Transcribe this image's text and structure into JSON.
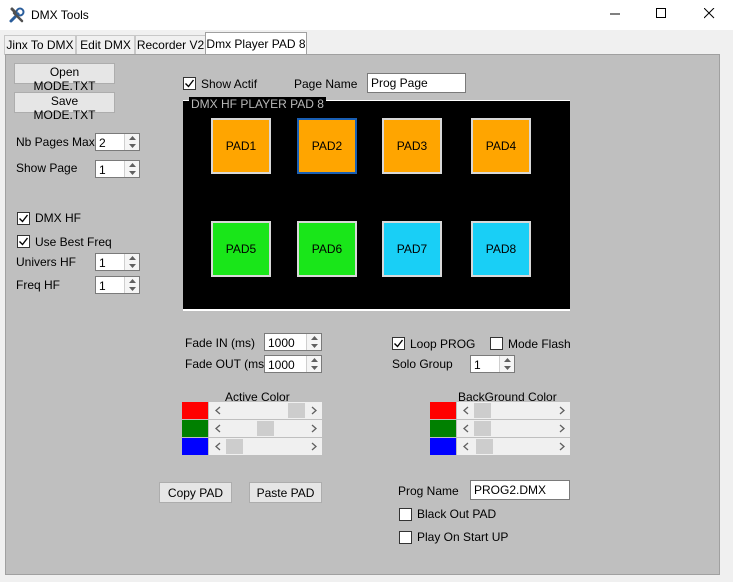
{
  "window": {
    "title": "DMX Tools"
  },
  "tabs": [
    "Jinx To DMX",
    "Edit DMX",
    "Recorder V2",
    "Dmx Player PAD 8"
  ],
  "left": {
    "open_label": "Open MODE.TXT",
    "save_label": "Save MODE.TXT",
    "nb_pages_label": "Nb Pages Max",
    "nb_pages_value": "2",
    "show_page_label": "Show Page",
    "show_page_value": "1",
    "dmx_hf_label": "DMX HF",
    "dmx_hf_checked": true,
    "best_freq_label": "Use Best Freq",
    "best_freq_checked": true,
    "univers_label": "Univers HF",
    "univers_value": "1",
    "freq_label": "Freq HF",
    "freq_value": "1"
  },
  "top": {
    "show_actif_label": "Show Actif",
    "show_actif_checked": true,
    "page_name_label": "Page Name",
    "page_name_value": "Prog Page"
  },
  "player": {
    "group_title": "DMX HF PLAYER PAD 8",
    "pads": [
      {
        "label": "PAD1",
        "color": "#ffa500"
      },
      {
        "label": "PAD2",
        "color": "#ffa500"
      },
      {
        "label": "PAD3",
        "color": "#ffa500"
      },
      {
        "label": "PAD4",
        "color": "#ffa500"
      },
      {
        "label": "PAD5",
        "color": "#19e619"
      },
      {
        "label": "PAD6",
        "color": "#19e619"
      },
      {
        "label": "PAD7",
        "color": "#19cff6"
      },
      {
        "label": "PAD8",
        "color": "#19cff6"
      }
    ]
  },
  "fade": {
    "in_label": "Fade IN (ms)",
    "in_value": "1000",
    "out_label": "Fade OUT (ms)",
    "out_value": "1000"
  },
  "options": {
    "loop_label": "Loop PROG",
    "loop_checked": true,
    "flash_label": "Mode Flash",
    "flash_checked": false,
    "solo_label": "Solo Group",
    "solo_value": "1"
  },
  "active_color": {
    "label": "Active Color",
    "levels": {
      "red": 1.0,
      "green": 0.5,
      "blue": 0.0
    },
    "swatches": [
      "#ff0000",
      "#008000",
      "#0000ff"
    ]
  },
  "background_color": {
    "label": "BackGround Color",
    "levels": {
      "red": 0.0,
      "green": 0.0,
      "blue": 0.04
    },
    "swatches": [
      "#ff0000",
      "#008000",
      "#0000ff"
    ]
  },
  "actions": {
    "copy_label": "Copy PAD",
    "paste_label": "Paste PAD"
  },
  "prog": {
    "name_label": "Prog Name",
    "name_value": "PROG2.DMX",
    "blackout_label": "Black Out PAD",
    "blackout_checked": false,
    "play_label": "Play On Start UP",
    "play_checked": false
  }
}
